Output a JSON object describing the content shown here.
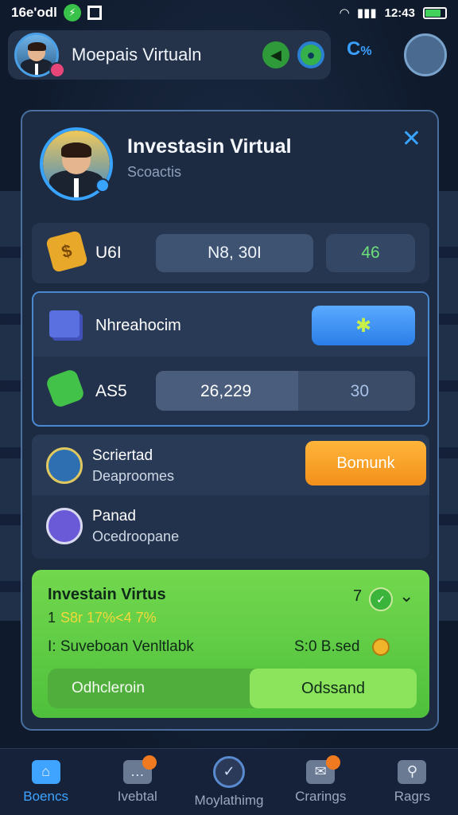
{
  "status_bar": {
    "left_text": "16e'odl",
    "time": "12:43"
  },
  "header": {
    "title": "Moepais Virtualn",
    "icon_pct": "%"
  },
  "panel": {
    "title": "Investasin Virtual",
    "subtitle": "Scoactis",
    "row1": {
      "label": "U6I",
      "value": "N8, 30I",
      "count": "46"
    },
    "row2": {
      "label": "Nhreahocim"
    },
    "row3": {
      "label": "AS5",
      "value": "26,229",
      "secondary": "30",
      "progress": 0.55
    },
    "item1": {
      "title": "Scriertad",
      "subtitle": "Deaproomes",
      "button": "Bomunk"
    },
    "item2": {
      "title": "Panad",
      "subtitle": "Ocedroopane"
    },
    "card": {
      "title": "Investain Virtus",
      "count_prefix": "1",
      "percent_text": "S8r 17%<4 7%",
      "num": "7",
      "row_left": "I: Suveboan Venltlabk",
      "row_right": "S:0 B.sed",
      "field": "Odhcleroin",
      "button": "Odssand"
    }
  },
  "nav": [
    {
      "label": "Boencs",
      "icon": "home-icon",
      "active": true
    },
    {
      "label": "Ivebtal",
      "icon": "chat-icon",
      "active": false
    },
    {
      "label": "Moylathimg",
      "icon": "check-circle-icon",
      "active": false
    },
    {
      "label": "Crarings",
      "icon": "mail-icon",
      "active": false
    },
    {
      "label": "Ragrs",
      "icon": "pin-icon",
      "active": false
    }
  ],
  "colors": {
    "accent": "#3ea4ff",
    "green": "#4fc03c",
    "orange": "#f2901a"
  }
}
